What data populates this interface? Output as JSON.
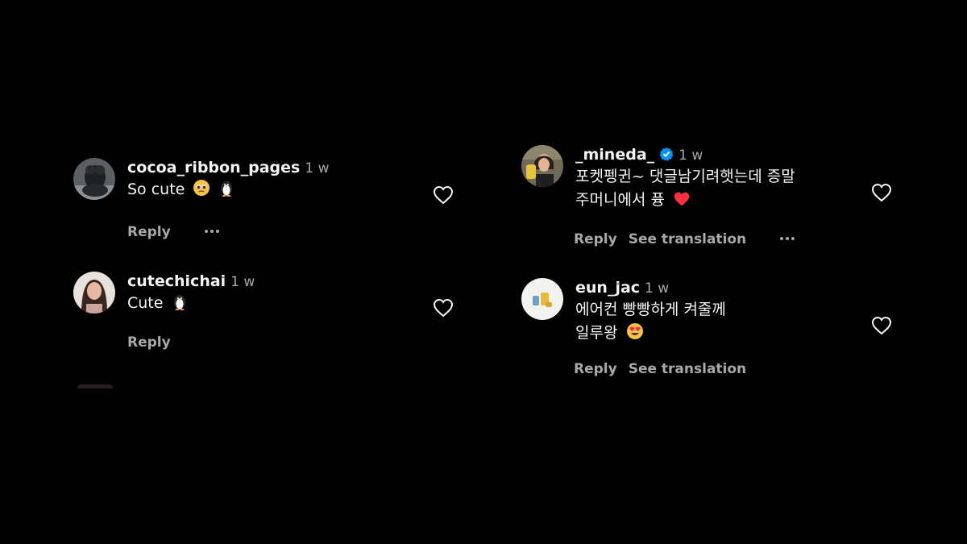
{
  "comments": [
    {
      "username": "cocoa_ribbon_pages",
      "time": "1 w",
      "text": "So cute",
      "emojis": [
        "pleading-face-emoji",
        "penguin-emoji"
      ],
      "reply_label": "Reply",
      "has_more": true
    },
    {
      "username": "cutechichai",
      "time": "1 w",
      "text": "Cute",
      "emojis": [
        "penguin-emoji"
      ],
      "reply_label": "Reply"
    },
    {
      "username": "_mineda_",
      "verified": true,
      "time": "1 w",
      "text_line1": "포켓펭귄~ 댓글남기려햇는데 증말",
      "text_line2": "주머니에서 퓽",
      "emojis": [
        "red-heart-emoji"
      ],
      "reply_label": "Reply",
      "see_translation_label": "See translation",
      "has_more": true
    },
    {
      "username": "eun_jac",
      "time": "1 w",
      "text_line1": "에어컨 빵빵하게 켜줄께",
      "text_line2": "일루왕",
      "emojis": [
        "heart-eyes-emoji"
      ],
      "reply_label": "Reply",
      "see_translation_label": "See translation"
    }
  ],
  "colors": {
    "background": "#000000",
    "primary_text": "#f5f5f5",
    "secondary_text": "#a8a8a8",
    "verified_blue": "#0095f6",
    "heart_red": "#ff3040"
  }
}
